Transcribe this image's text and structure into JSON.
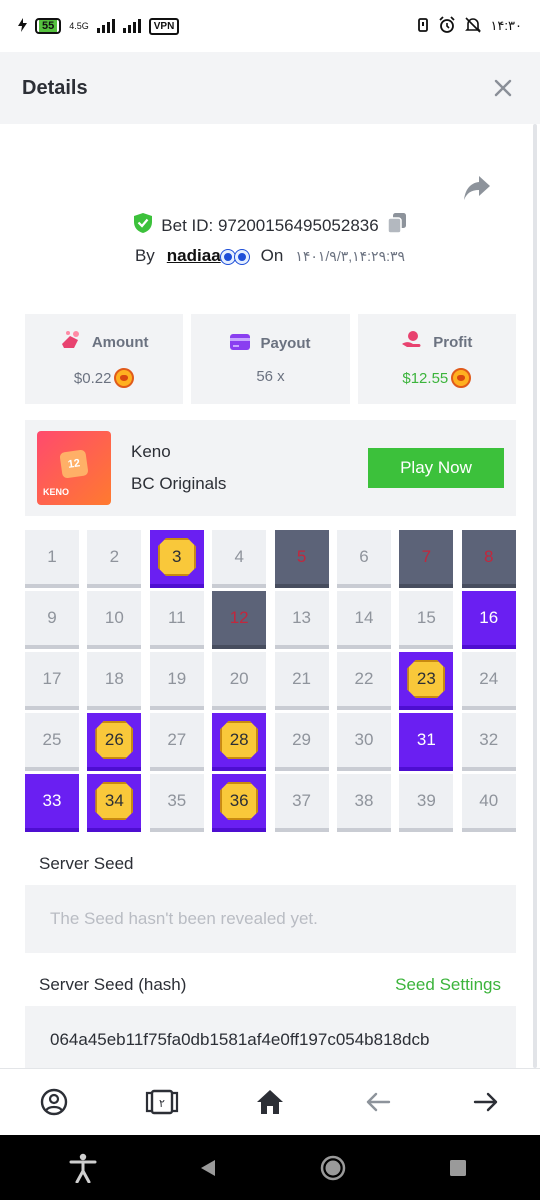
{
  "status_bar": {
    "battery": "55",
    "network": "4.5G",
    "vpn": "VPN",
    "time": "۱۴:۳۰"
  },
  "header": {
    "title": "Details"
  },
  "bet": {
    "id_label": "Bet ID: 97200156495052836",
    "by_label": "By",
    "user": "nadiaa",
    "on_label": "On",
    "date": "۱۴۰۱/۹/۳,۱۴:۲۹:۳۹"
  },
  "stats": {
    "amount": {
      "label": "Amount",
      "value": "$0.22"
    },
    "payout": {
      "label": "Payout",
      "value": "56 x"
    },
    "profit": {
      "label": "Profit",
      "value": "$12.55"
    }
  },
  "game": {
    "thumb_number": "12",
    "thumb_label": "KENO",
    "name": "Keno",
    "provider": "BC Originals",
    "play_button": "Play Now"
  },
  "keno": {
    "cells": [
      {
        "n": "1",
        "s": "none"
      },
      {
        "n": "2",
        "s": "none"
      },
      {
        "n": "3",
        "s": "hit"
      },
      {
        "n": "4",
        "s": "none"
      },
      {
        "n": "5",
        "s": "miss"
      },
      {
        "n": "6",
        "s": "none"
      },
      {
        "n": "7",
        "s": "miss"
      },
      {
        "n": "8",
        "s": "miss"
      },
      {
        "n": "9",
        "s": "none"
      },
      {
        "n": "10",
        "s": "none"
      },
      {
        "n": "11",
        "s": "none"
      },
      {
        "n": "12",
        "s": "miss"
      },
      {
        "n": "13",
        "s": "none"
      },
      {
        "n": "14",
        "s": "none"
      },
      {
        "n": "15",
        "s": "none"
      },
      {
        "n": "16",
        "s": "sel"
      },
      {
        "n": "17",
        "s": "none"
      },
      {
        "n": "18",
        "s": "none"
      },
      {
        "n": "19",
        "s": "none"
      },
      {
        "n": "20",
        "s": "none"
      },
      {
        "n": "21",
        "s": "none"
      },
      {
        "n": "22",
        "s": "none"
      },
      {
        "n": "23",
        "s": "hit"
      },
      {
        "n": "24",
        "s": "none"
      },
      {
        "n": "25",
        "s": "none"
      },
      {
        "n": "26",
        "s": "hit"
      },
      {
        "n": "27",
        "s": "none"
      },
      {
        "n": "28",
        "s": "hit"
      },
      {
        "n": "29",
        "s": "none"
      },
      {
        "n": "30",
        "s": "none"
      },
      {
        "n": "31",
        "s": "sel"
      },
      {
        "n": "32",
        "s": "none"
      },
      {
        "n": "33",
        "s": "sel"
      },
      {
        "n": "34",
        "s": "hit"
      },
      {
        "n": "35",
        "s": "none"
      },
      {
        "n": "36",
        "s": "hit"
      },
      {
        "n": "37",
        "s": "none"
      },
      {
        "n": "38",
        "s": "none"
      },
      {
        "n": "39",
        "s": "none"
      },
      {
        "n": "40",
        "s": "none"
      }
    ]
  },
  "seeds": {
    "server_seed_label": "Server Seed",
    "server_seed_placeholder": "The Seed hasn't been revealed yet.",
    "server_hash_label": "Server Seed (hash)",
    "seed_settings": "Seed Settings",
    "server_hash_value": "064a45eb11f75fa0db1581af4e0ff197c054b818dcb"
  },
  "bottom_nav": {
    "wallet_badge": "۲"
  },
  "colors": {
    "green": "#3cc13b",
    "purple": "#6a1ff2",
    "miss": "#5c6378"
  }
}
